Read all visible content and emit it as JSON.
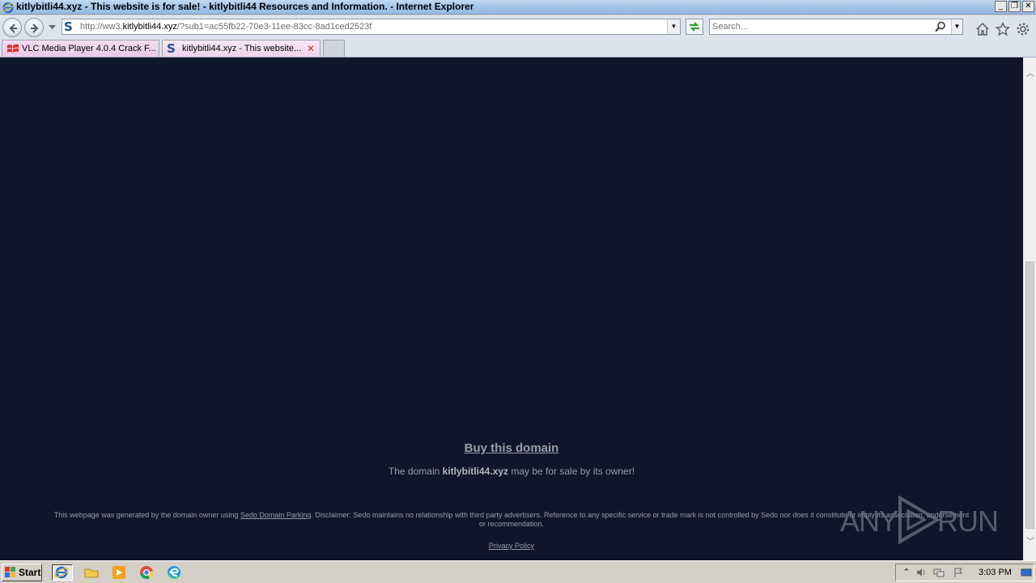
{
  "window": {
    "title": "kitlybitli44.xyz - This website is for sale! - kitlybitli44 Resources and Information. - Internet Explorer",
    "controls": {
      "minimize": "_",
      "restore": "❐",
      "close": "✕"
    }
  },
  "navbar": {
    "url_prefix": "http://ww3.",
    "url_domain": "kitlybitli44.xyz",
    "url_suffix": "/?sub1=ac55fb22-70e3-11ee-83cc-8ad1ced2523f",
    "search_placeholder": "Search..."
  },
  "tabs": [
    {
      "label": "VLC Media Player 4.0.4 Crack F...",
      "icon": "windows-flag-icon",
      "active": false
    },
    {
      "label": "kitlybitli44.xyz - This website...",
      "icon": "sedo-s-icon",
      "active": true
    }
  ],
  "page": {
    "buy_label": "Buy this domain",
    "domain_prefix": "The domain ",
    "domain_name": "kitlybitli44.xyz",
    "domain_suffix": " may be for sale by its owner!",
    "disclaimer_before": "This webpage was generated by the domain owner using ",
    "disclaimer_link": "Sedo Domain Parking",
    "disclaimer_after": ". Disclaimer: Sedo maintains no relationship with third party advertisers. Reference to any specific service or trade mark is not controlled by Sedo nor does it constitute or imply its association, endorsement or recommendation.",
    "privacy_label": "Privacy Policy",
    "background": "#0f152b"
  },
  "watermark": {
    "left": "ANY",
    "right": "RUN"
  },
  "taskbar": {
    "start_label": "Start",
    "clock": "3:03 PM",
    "pinned": [
      "internet-explorer-icon",
      "folder-icon",
      "media-player-icon",
      "chrome-icon",
      "edge-icon"
    ]
  }
}
